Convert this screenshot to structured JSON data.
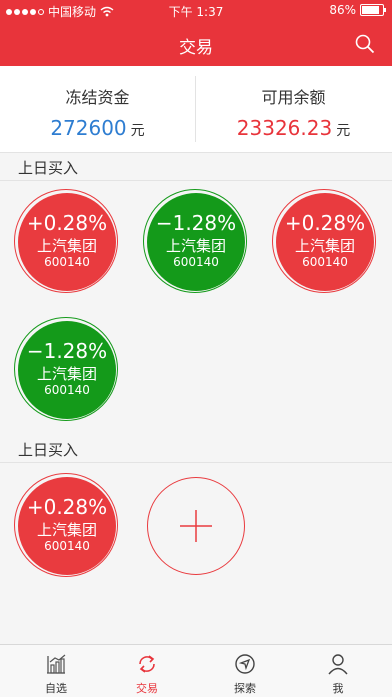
{
  "status": {
    "carrier": "中国移动",
    "time": "下午 1:37",
    "battery": "86%"
  },
  "nav": {
    "title": "交易"
  },
  "funds": {
    "frozen_label": "冻结资金",
    "frozen_value": "272600",
    "frozen_unit": "元",
    "available_label": "可用余额",
    "available_value": "23326.23",
    "available_unit": "元"
  },
  "sections": [
    {
      "title": "上日买入",
      "stocks": [
        {
          "pct": "+0.28%",
          "name": "上汽集团",
          "code": "600140",
          "trend": "up"
        },
        {
          "pct": "−1.28%",
          "name": "上汽集团",
          "code": "600140",
          "trend": "down"
        },
        {
          "pct": "+0.28%",
          "name": "上汽集团",
          "code": "600140",
          "trend": "up"
        },
        {
          "pct": "−1.28%",
          "name": "上汽集团",
          "code": "600140",
          "trend": "down"
        }
      ]
    },
    {
      "title": "上日买入",
      "stocks": [
        {
          "pct": "+0.28%",
          "name": "上汽集团",
          "code": "600140",
          "trend": "up"
        }
      ]
    }
  ],
  "tabs": [
    {
      "label": "自选",
      "icon": "chart-icon"
    },
    {
      "label": "交易",
      "icon": "refresh-icon"
    },
    {
      "label": "探索",
      "icon": "compass-icon"
    },
    {
      "label": "我",
      "icon": "user-icon"
    }
  ],
  "colors": {
    "brand": "#e8343b",
    "up": "#e93b3f",
    "down": "#149a1a",
    "frozen_value": "#2e7dd1",
    "available_value": "#e8343b"
  }
}
